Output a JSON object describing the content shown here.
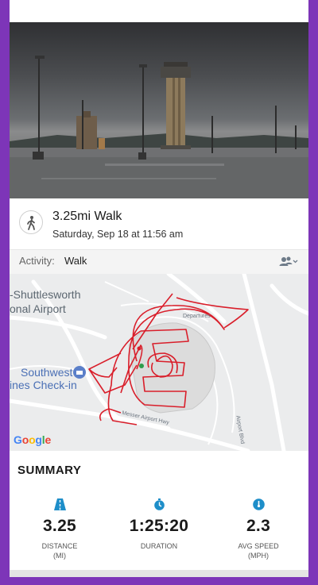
{
  "activity": {
    "title": "3.25mi Walk",
    "datetime": "Saturday, Sep 18 at 11:56 am",
    "icon": "walking-person-icon"
  },
  "activity_row": {
    "label": "Activity:",
    "value": "Walk",
    "action_icon": "people-dropdown-icon"
  },
  "map": {
    "labels": {
      "airport_line1": "-Shuttlesworth",
      "airport_line2": "onal Airport",
      "southwest_line1": "Southwest",
      "southwest_line2": "ines Check-in",
      "departures": "Departures",
      "messer": "Messer Airport Hwy",
      "airport_blvd": "Airport Blvd"
    },
    "attribution": "Google",
    "route_color": "#d91e2a"
  },
  "summary": {
    "title": "SUMMARY",
    "stats": [
      {
        "icon": "road-icon",
        "value": "3.25",
        "label": "DISTANCE\n(MI)"
      },
      {
        "icon": "stopwatch-icon",
        "value": "1:25:20",
        "label": "DURATION"
      },
      {
        "icon": "speedometer-icon",
        "value": "2.3",
        "label": "AVG SPEED\n(MPH)"
      }
    ],
    "accent": "#1e8ec9"
  }
}
